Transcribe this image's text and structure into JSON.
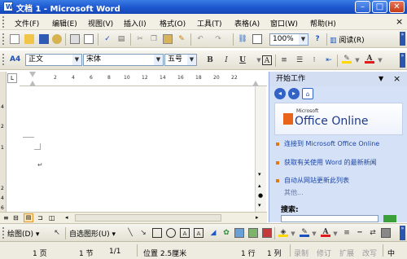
{
  "window": {
    "title": "文档 1 - Microsoft Word",
    "app_icon_letter": "W",
    "controls": {
      "minimize": "–",
      "maximize": "□",
      "close": "✕"
    }
  },
  "menubar": {
    "items": [
      {
        "label": "文件(F)"
      },
      {
        "label": "编辑(E)"
      },
      {
        "label": "视图(V)"
      },
      {
        "label": "插入(I)"
      },
      {
        "label": "格式(O)"
      },
      {
        "label": "工具(T)"
      },
      {
        "label": "表格(A)"
      },
      {
        "label": "窗口(W)"
      },
      {
        "label": "帮助(H)"
      }
    ],
    "close_doc": "×"
  },
  "standard_toolbar": {
    "zoom": "100%",
    "read_button": "阅读(R)",
    "icons": [
      "new-document-icon",
      "open-folder-icon",
      "save-icon",
      "permission-icon",
      "print-icon",
      "print-preview-icon",
      "spelling-icon",
      "research-icon",
      "cut-icon",
      "copy-icon",
      "paste-icon",
      "format-painter-icon",
      "undo-icon",
      "redo-icon",
      "insert-hyperlink-icon",
      "tables-borders-icon",
      "help-icon"
    ]
  },
  "format_toolbar": {
    "style_marker": "A4",
    "style": "正文",
    "font": "宋体",
    "size": "五号",
    "bold": "B",
    "italic": "I",
    "underline": "U",
    "char_border": "A",
    "font_color_letter": "A"
  },
  "ruler": {
    "tab_selector": "L",
    "numbers": [
      "2",
      "4",
      "6",
      "8",
      "10",
      "12",
      "14",
      "16",
      "18",
      "20",
      "22"
    ]
  },
  "left_ruler": {
    "marks": [
      "4",
      "2",
      "1",
      "2",
      "4",
      "6"
    ]
  },
  "document": {
    "paragraph_mark": "↵"
  },
  "task_pane": {
    "title": "开始工作",
    "close": "×",
    "logo_small": "Microsoft",
    "logo_text": "Office Online",
    "links": [
      {
        "text": "连接到 Microsoft Office Online"
      },
      {
        "text": "获取有关使用 Word 的最新新闻"
      },
      {
        "text": "自动从网站更新此列表"
      }
    ],
    "more": "其他...",
    "search_label": "搜索:"
  },
  "drawing_toolbar": {
    "draw_menu": "绘图(D)",
    "autoshapes_menu": "自选图形(U)"
  },
  "status_bar": {
    "page": "1 页",
    "section": "1 节",
    "page_of": "1/1",
    "position": "位置 2.5厘米",
    "line": "1 行",
    "column": "1 列",
    "modes": [
      "录制",
      "修订",
      "扩展",
      "改写"
    ],
    "language": "中"
  },
  "colors": {
    "title_bar": "#1f5ad2",
    "menu_bg": "#f2efe4",
    "pane_bg": "#d5e1f6",
    "link_blue": "#1b46a8",
    "bullet_orange": "#e07a12"
  }
}
